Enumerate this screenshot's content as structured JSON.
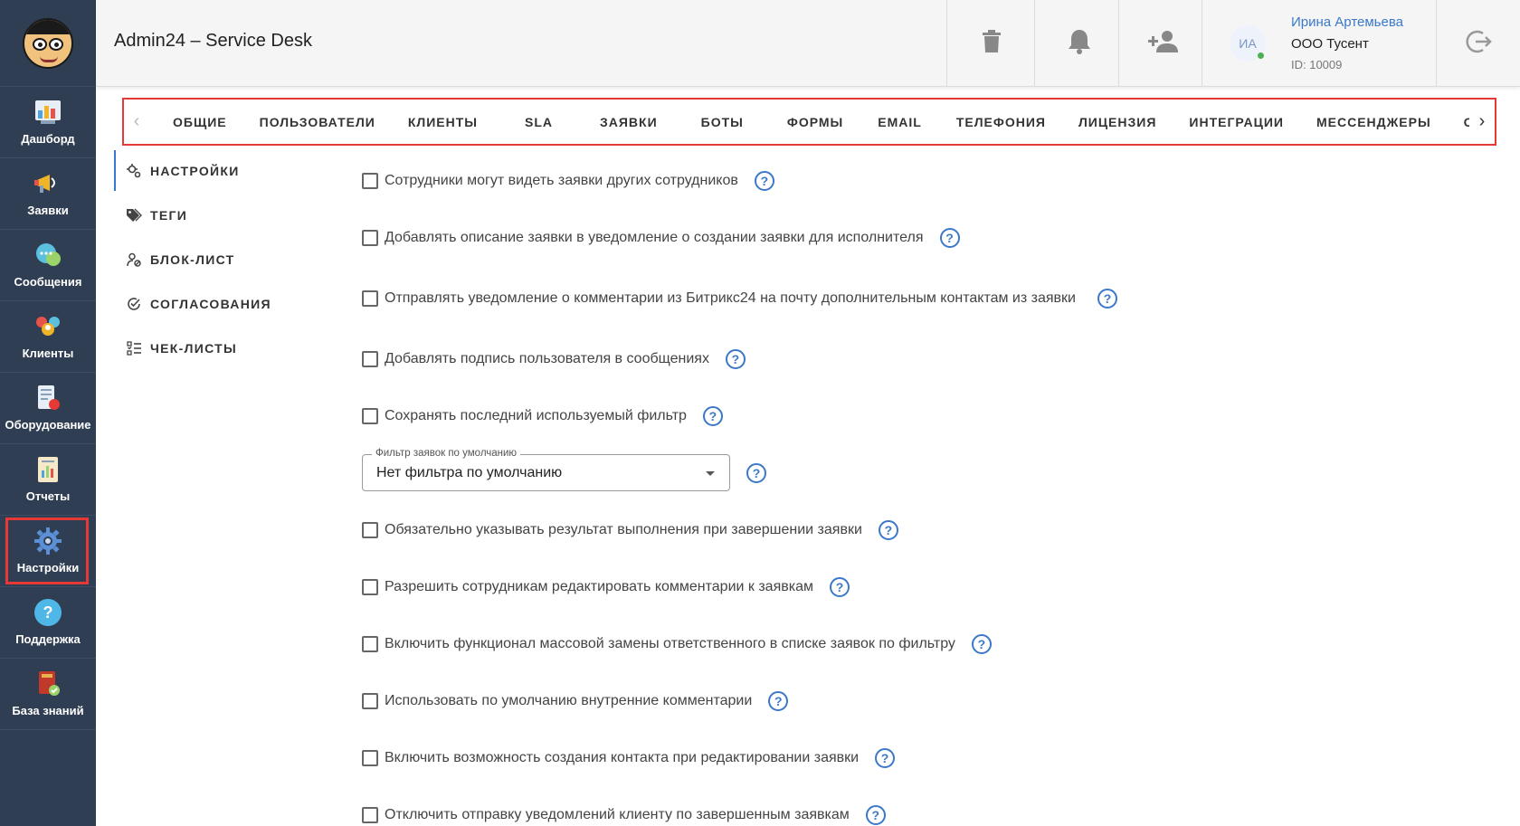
{
  "header": {
    "title": "Admin24 – Service Desk",
    "user": {
      "initials": "ИА",
      "name": "Ирина Артемьева",
      "org": "ООО Тусент",
      "id": "ID: 10009"
    }
  },
  "sidebar": {
    "items": [
      {
        "label": "Дашборд",
        "icon": "dashboard-icon"
      },
      {
        "label": "Заявки",
        "icon": "megaphone-icon"
      },
      {
        "label": "Сообщения",
        "icon": "chat-icon"
      },
      {
        "label": "Клиенты",
        "icon": "clients-icon"
      },
      {
        "label": "Оборудование",
        "icon": "equipment-icon"
      },
      {
        "label": "Отчеты",
        "icon": "reports-icon"
      },
      {
        "label": "Настройки",
        "icon": "gear-icon"
      },
      {
        "label": "Поддержка",
        "icon": "help-icon"
      },
      {
        "label": "База знаний",
        "icon": "book-icon"
      }
    ]
  },
  "tabs": [
    "ОБЩИЕ",
    "ПОЛЬЗОВАТЕЛИ",
    "КЛИЕНТЫ",
    "SLA",
    "ЗАЯВКИ",
    "БОТЫ",
    "ФОРМЫ",
    "EMAIL",
    "ТЕЛЕФОНИЯ",
    "ЛИЦЕНЗИЯ",
    "ИНТЕГРАЦИИ",
    "МЕССЕНДЖЕРЫ",
    "ОТКРЫ"
  ],
  "submenu": {
    "items": [
      {
        "label": "НАСТРОЙКИ",
        "icon": "gears-icon"
      },
      {
        "label": "ТЕГИ",
        "icon": "tags-icon"
      },
      {
        "label": "БЛОК-ЛИСТ",
        "icon": "user-block-icon"
      },
      {
        "label": "СОГЛАСОВАНИЯ",
        "icon": "check-circle-icon"
      },
      {
        "label": "ЧЕК-ЛИСТЫ",
        "icon": "checklist-icon"
      }
    ]
  },
  "settings": {
    "r0": "Сотрудники могут видеть заявки других сотрудников",
    "r1": "Добавлять описание заявки в уведомление о создании заявки для исполнителя",
    "r2": "Отправлять уведомление о комментарии из Битрикс24 на почту дополнительным контактам из заявки",
    "r3": "Добавлять подпись пользователя в сообщениях",
    "r4": "Сохранять последний используемый фильтр",
    "filter_legend": "Фильтр заявок по умолчанию",
    "filter_value": "Нет фильтра по умолчанию",
    "r5": "Обязательно указывать результат выполнения при завершении заявки",
    "r6": "Разрешить сотрудникам редактировать комментарии к заявкам",
    "r7": "Включить функционал массовой замены ответственного в списке заявок по фильтру",
    "r8": "Использовать по умолчанию внутренние комментарии",
    "r9": "Включить возможность создания контакта при редактировании заявки",
    "r10": "Отключить отправку уведомлений клиенту по завершенным заявкам",
    "help_symbol": "?"
  },
  "colors": {
    "sidebar_bg": "#2f3e52",
    "accent": "#3b78c9",
    "highlight": "#e53935"
  }
}
